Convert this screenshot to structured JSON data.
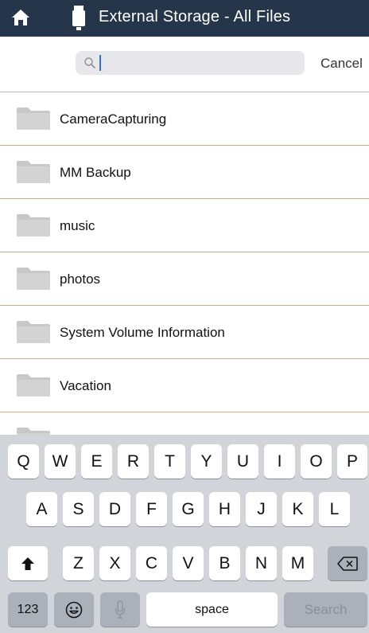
{
  "header": {
    "title": "External Storage - All Files",
    "home_icon": "home-icon",
    "drive_icon": "usb-drive-icon",
    "background": "#25364a"
  },
  "search": {
    "placeholder": "",
    "value": "",
    "cancel_label": "Cancel"
  },
  "files": [
    {
      "name": "CameraCapturing",
      "icon": "folder-icon"
    },
    {
      "name": "MM Backup",
      "icon": "folder-icon"
    },
    {
      "name": "music",
      "icon": "folder-icon"
    },
    {
      "name": "photos",
      "icon": "folder-icon"
    },
    {
      "name": "System Volume Information",
      "icon": "folder-icon"
    },
    {
      "name": "Vacation",
      "icon": "folder-icon"
    }
  ],
  "keyboard": {
    "row1": [
      "Q",
      "W",
      "E",
      "R",
      "T",
      "Y",
      "U",
      "I",
      "O",
      "P"
    ],
    "row2": [
      "A",
      "S",
      "D",
      "F",
      "G",
      "H",
      "J",
      "K",
      "L"
    ],
    "row3": [
      "Z",
      "X",
      "C",
      "V",
      "B",
      "N",
      "M"
    ],
    "numbers_label": "123",
    "space_label": "space",
    "search_label": "Search"
  },
  "colors": {
    "separator": "#c6ad84",
    "keyboard_bg": "#d1d4d9"
  }
}
